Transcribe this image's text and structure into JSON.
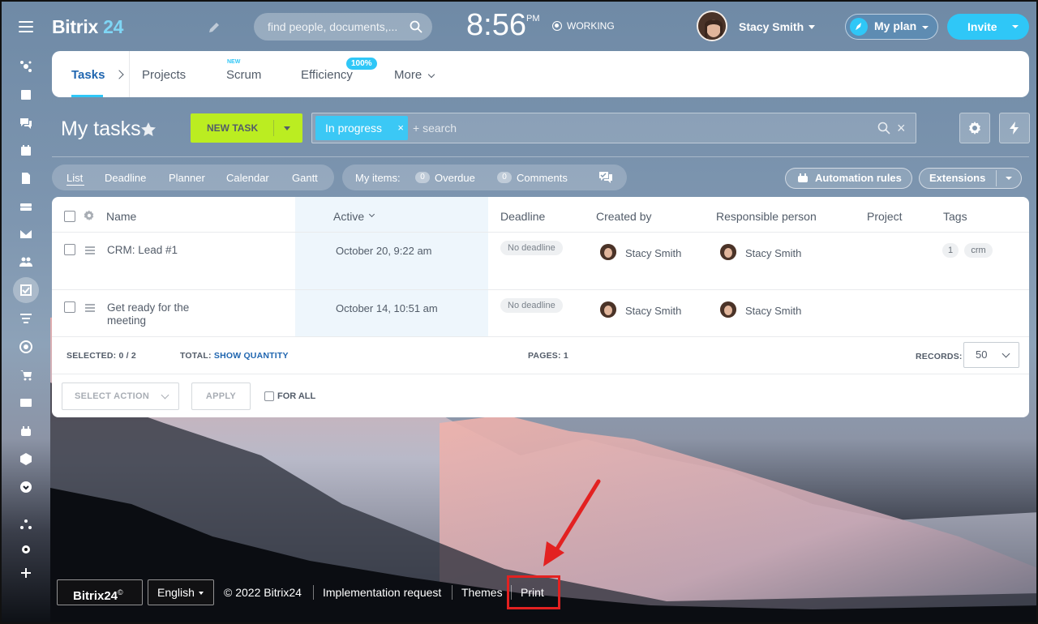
{
  "colors": {
    "accent_blue": "#2fc7f7",
    "new_task_green": "#bbed21",
    "link_blue": "#2066b0",
    "annotation_red": "#e32121"
  },
  "sidebar": {
    "icons": [
      "menu-icon",
      "live-feed-icon",
      "feed-icon",
      "chat-icon",
      "calendar-icon",
      "documents-icon",
      "drive-icon",
      "mail-icon",
      "employees-icon",
      "tasks-icon",
      "crm-icon",
      "marketing-icon",
      "store-icon",
      "contact-card-icon",
      "automation-icon",
      "box-icon",
      "more-icon",
      "sitemap-icon",
      "settings-icon",
      "add-icon"
    ]
  },
  "header": {
    "logo_text": "Bitrix",
    "logo_num": "24",
    "search_placeholder": "find people, documents,...",
    "clock": "8:56",
    "clock_ampm": "PM",
    "working_status": "WORKING",
    "user_name": "Stacy Smith",
    "my_plan_label": "My plan",
    "invite_label": "Invite"
  },
  "nav": {
    "tabs": [
      {
        "label": "Tasks",
        "active": true
      },
      {
        "label": "Projects"
      },
      {
        "label": "Scrum",
        "badge": "NEW"
      },
      {
        "label": "Efficiency",
        "badge": "100%"
      },
      {
        "label": "More"
      }
    ]
  },
  "toolbar": {
    "page_title": "My tasks",
    "new_task_label": "NEW TASK",
    "filter_chip": "In progress",
    "filter_chip_close": "×",
    "search_placeholder": "+ search",
    "clear_icon": "×"
  },
  "views": {
    "items": [
      "List",
      "Deadline",
      "Planner",
      "Calendar",
      "Gantt"
    ],
    "active": "List"
  },
  "my_items": {
    "label": "My items:",
    "overdue_count": "0",
    "overdue_label": "Overdue",
    "comments_count": "0",
    "comments_label": "Comments"
  },
  "buttons": {
    "automation_rules": "Automation rules",
    "extensions": "Extensions"
  },
  "table": {
    "columns": [
      "Name",
      "Active",
      "Deadline",
      "Created by",
      "Responsible person",
      "Project",
      "Tags"
    ],
    "rows": [
      {
        "name": "CRM: Lead #1",
        "active": "October 20, 9:22 am",
        "deadline": "No deadline",
        "created_by": "Stacy Smith",
        "responsible": "Stacy Smith",
        "project": "",
        "tag_count": "1",
        "tag": "crm"
      },
      {
        "name": "Get ready for the meeting",
        "active": "October 14, 10:51 am",
        "deadline": "No deadline",
        "created_by": "Stacy Smith",
        "responsible": "Stacy Smith",
        "project": "",
        "tag_count": "",
        "tag": ""
      }
    ],
    "selected_label": "SELECTED:",
    "selected_value": "0 / 2",
    "total_label": "TOTAL:",
    "total_link": "SHOW QUANTITY",
    "pages_label": "PAGES:",
    "pages_value": "1",
    "records_label": "RECORDS:",
    "records_value": "50",
    "select_action": "SELECT ACTION",
    "apply": "APPLY",
    "for_all": "FOR ALL"
  },
  "footer": {
    "brand": "Bitrix24",
    "brand_mark": "©",
    "language": "English",
    "copyright": "© 2022 Bitrix24",
    "implementation": "Implementation request",
    "themes": "Themes",
    "print": "Print"
  }
}
